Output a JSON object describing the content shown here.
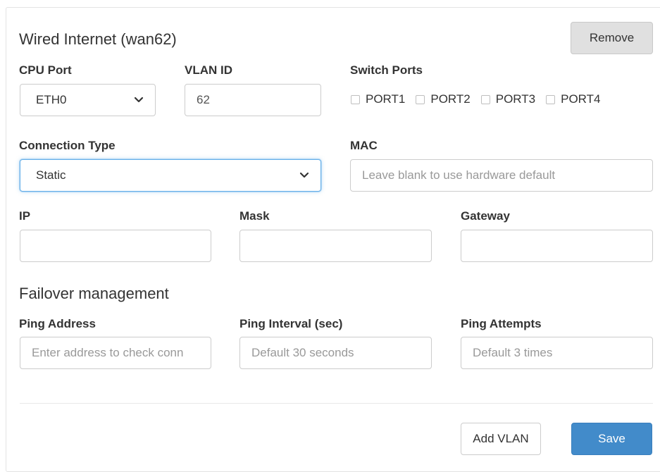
{
  "section": {
    "title": "Wired Internet (wan62)",
    "remove_label": "Remove"
  },
  "cpu_port": {
    "label": "CPU Port",
    "value": "ETH0"
  },
  "vlan_id": {
    "label": "VLAN ID",
    "value": "62"
  },
  "switch_ports": {
    "label": "Switch Ports",
    "ports": [
      {
        "label": "PORT1",
        "checked": false
      },
      {
        "label": "PORT2",
        "checked": false
      },
      {
        "label": "PORT3",
        "checked": false
      },
      {
        "label": "PORT4",
        "checked": false
      }
    ]
  },
  "connection_type": {
    "label": "Connection Type",
    "value": "Static"
  },
  "mac": {
    "label": "MAC",
    "placeholder": "Leave blank to use hardware default",
    "value": ""
  },
  "ip": {
    "label": "IP",
    "value": ""
  },
  "mask": {
    "label": "Mask",
    "value": ""
  },
  "gateway": {
    "label": "Gateway",
    "value": ""
  },
  "failover": {
    "title": "Failover management",
    "ping_address": {
      "label": "Ping Address",
      "placeholder": "Enter address to check conn"
    },
    "ping_interval": {
      "label": "Ping Interval (sec)",
      "placeholder": "Default 30 seconds"
    },
    "ping_attempts": {
      "label": "Ping Attempts",
      "placeholder": "Default 3 times"
    }
  },
  "footer": {
    "add_vlan_label": "Add VLAN",
    "save_label": "Save"
  },
  "colors": {
    "primary": "#428bca",
    "focus": "#66afe9",
    "remove_bg": "#e0e0e0"
  }
}
